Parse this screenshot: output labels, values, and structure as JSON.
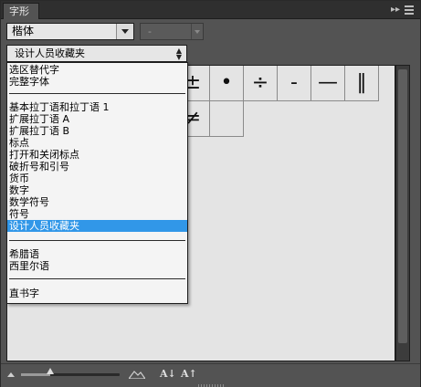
{
  "panel": {
    "tab_label": "字形",
    "expand_glyph": "▸▸",
    "menu_icon": "menu-icon"
  },
  "font_family": {
    "value": "楷体"
  },
  "font_style": {
    "value": "-"
  },
  "show": {
    "value": "设计人员收藏夹"
  },
  "glyphs": {
    "row1": [
      "",
      "",
      "",
      "",
      "",
      "",
      "",
      "",
      "",
      "",
      ""
    ],
    "row2": [
      "",
      "",
      "",
      "",
      "",
      "",
      "",
      "",
      "",
      "",
      ""
    ],
    "row3": [
      "",
      "",
      "",
      "",
      "",
      "",
      "",
      "",
      "",
      "",
      ""
    ]
  },
  "dropdown": {
    "group1": [
      "选区替代字",
      "完整字体"
    ],
    "group2": [
      "基本拉丁语和拉丁语 1",
      "扩展拉丁语 A",
      "扩展拉丁语 B",
      "标点",
      "打开和关闭标点",
      "破折号和引号",
      "货币",
      "数字",
      "数学符号",
      "符号",
      "设计人员收藏夹"
    ],
    "group3": [
      "希腊语",
      "西里尔语"
    ],
    "group4": [
      "直书字"
    ],
    "selected": "设计人员收藏夹"
  },
  "bottom": {
    "font_smaller_label": "A↓",
    "font_larger_label": "A↑",
    "zoom_fraction": 0.3
  },
  "colors": {
    "selection": "#3197e8",
    "panel_bg": "#535353",
    "grid_bg": "#e4e4e4"
  }
}
